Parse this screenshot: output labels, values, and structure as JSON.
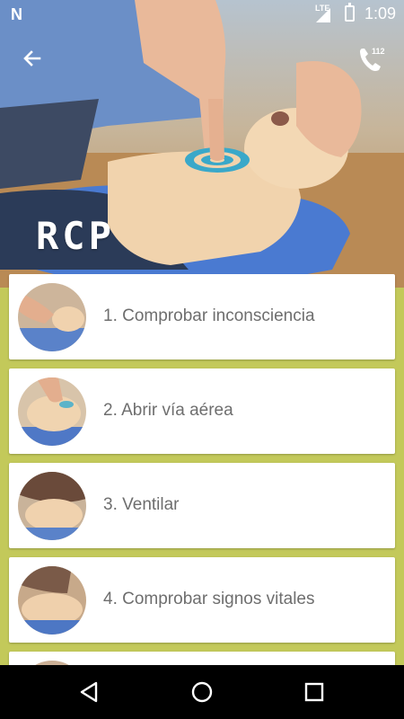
{
  "status_bar": {
    "network": "LTE",
    "time": "1:09"
  },
  "app_bar": {
    "back_icon": "arrow-back-icon",
    "call_icon": "phone-icon",
    "call_badge": "112"
  },
  "hero": {
    "title": "RCP"
  },
  "steps": [
    {
      "label": "1. Comprobar inconsciencia"
    },
    {
      "label": "2. Abrir vía aérea"
    },
    {
      "label": "3. Ventilar"
    },
    {
      "label": "4. Comprobar signos vitales"
    }
  ],
  "nav_bar": {
    "icons": [
      "back-triangle-icon",
      "home-circle-icon",
      "recents-square-icon"
    ]
  },
  "colors": {
    "list_background": "#c3c95a",
    "card": "#ffffff",
    "text": "#6e6e6e",
    "target_ring": "#3aa8c9"
  }
}
